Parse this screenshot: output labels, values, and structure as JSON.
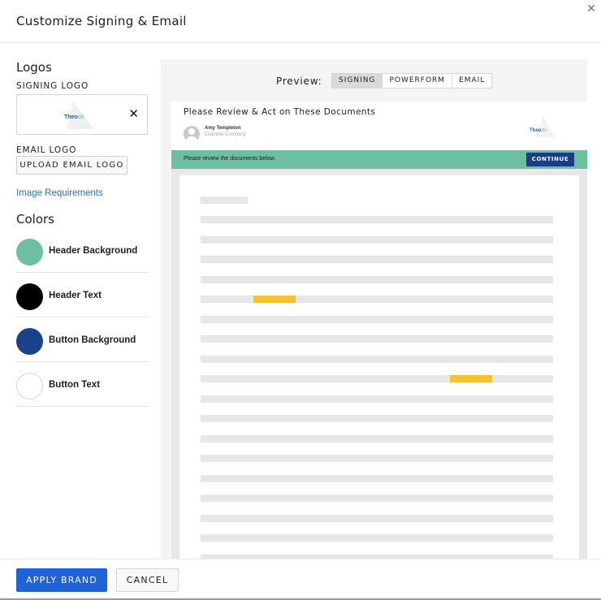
{
  "dialog": {
    "title": "Customize Signing & Email",
    "close_icon": "close-icon"
  },
  "sidebar": {
    "logos_heading": "Logos",
    "signing_logo_label": "SIGNING LOGO",
    "signing_logo": {
      "text_main": "Theo",
      "text_accent": "do",
      "remove_icon": "close-icon",
      "remove_glyph": "✕"
    },
    "email_logo_label": "EMAIL LOGO",
    "upload_email_logo": "UPLOAD EMAIL LOGO",
    "image_requirements_link": "Image Requirements",
    "colors_heading": "Colors",
    "colors": [
      {
        "label": "Header Background",
        "color": "#6cbf9f"
      },
      {
        "label": "Header Text",
        "color": "#000000"
      },
      {
        "label": "Button Background",
        "color": "#1a428a"
      },
      {
        "label": "Button Text",
        "color": "#ffffff"
      }
    ]
  },
  "preview": {
    "label": "Preview:",
    "tabs": [
      {
        "label": "SIGNING",
        "active": true
      },
      {
        "label": "POWERFORM",
        "active": false
      },
      {
        "label": "EMAIL",
        "active": false
      }
    ],
    "document": {
      "title": "Please Review & Act on These Documents",
      "sender_name": "Amy Templeton",
      "sender_company": "Example Company",
      "logo_main": "Theo",
      "logo_accent": "do",
      "banner_text": "Please review the documents below.",
      "continue_label": "CONTINUE"
    }
  },
  "footer": {
    "apply_label": "APPLY BRAND",
    "cancel_label": "CANCEL"
  }
}
